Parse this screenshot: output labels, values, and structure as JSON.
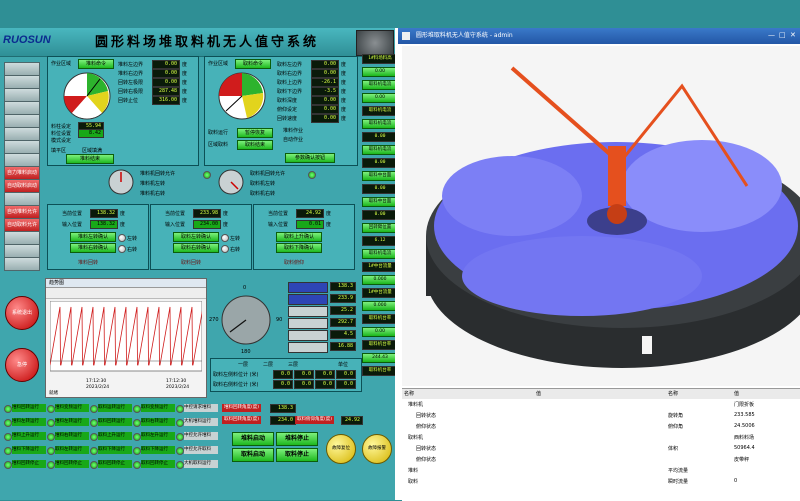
{
  "header": {
    "logo": "RUOSUN",
    "title": "圆形料场堆取料机无人值守系统"
  },
  "sidebar_buttons": [
    "",
    "",
    "",
    "",
    "",
    "",
    "",
    "",
    "自力堆料启动请",
    "自动取料启动请",
    "",
    "自动堆料允许",
    "自动取料允许",
    "",
    "",
    ""
  ],
  "round_buttons": {
    "stop": "系统退出",
    "alarm": "急停"
  },
  "stacker_panel": {
    "mode_label": "作业区域",
    "mode_value": "堆料命令",
    "fields": [
      {
        "label": "堆料左边界",
        "value": "0.00",
        "unit": "度"
      },
      {
        "label": "堆料右边界",
        "value": "0.00",
        "unit": "度"
      },
      {
        "label": "回转左极限",
        "value": "0.00",
        "unit": "度"
      },
      {
        "label": "回转右极限",
        "value": "287.48",
        "unit": "度"
      },
      {
        "label": "回转止位",
        "value": "316.00",
        "unit": "度"
      }
    ],
    "extra": [
      {
        "label": "料柱设定",
        "value": "55.94"
      },
      {
        "label": "料位设置",
        "value": "8.42"
      },
      {
        "label": "模式设定",
        "value": ""
      }
    ],
    "check1": "填平区",
    "check2": "区域填满",
    "confirm": "堆料结束"
  },
  "reclaimer_panel": {
    "mode_label": "作业区域",
    "mode_value": "取料命令",
    "fields": [
      {
        "label": "取料左边界",
        "value": "0.00",
        "unit": "度"
      },
      {
        "label": "取料右边界",
        "value": "0.00",
        "unit": "度"
      },
      {
        "label": "取料上边界",
        "value": "-26.1",
        "unit": "度"
      },
      {
        "label": "取料下边界",
        "value": "-3.5",
        "unit": "度"
      },
      {
        "label": "取料深度",
        "value": "0.00",
        "unit": "度"
      },
      {
        "label": "俯仰设定",
        "value": "0.00",
        "unit": "度"
      },
      {
        "label": "回转速度",
        "value": "0.00",
        "unit": "度"
      }
    ],
    "checks": [
      "堆料作业",
      "自动作业"
    ],
    "btn1": "参数确认按钮",
    "btn2": "参数确认按钮",
    "sub": [
      "取料运行",
      "暂停恢复",
      "区域取料",
      "取料结束"
    ]
  },
  "compass1": {
    "label": "堆料机回转允许",
    "sub": [
      "堆料机左转",
      "堆料机右转"
    ]
  },
  "compass2": {
    "label": "取料机回转允许",
    "sub": [
      "取料机左转",
      "取料机右转"
    ]
  },
  "positions": [
    {
      "cur_label": "当前位置",
      "cur": "138.32",
      "in_label": "输入位置",
      "in": "138.32",
      "unit": "度",
      "b1": "堆料左转确认",
      "b2": "堆料右转确认",
      "r1": "左转",
      "r2": "右转",
      "foot": "堆料回转"
    },
    {
      "cur_label": "当前位置",
      "cur": "233.98",
      "in_label": "输入位置",
      "in": "234.00",
      "unit": "度",
      "b1": "取料左转确认",
      "b2": "取料右转确认",
      "r1": "左转",
      "r2": "右转",
      "foot": "取料回转"
    },
    {
      "cur_label": "当前位置",
      "cur": "24.92",
      "in_label": "输入位置",
      "in": "0.01",
      "unit": "度",
      "b1": "取料上升确认",
      "b2": "取料下降确认",
      "r1": "",
      "r2": "",
      "foot": "取料俯仰"
    }
  ],
  "trend": {
    "title": "趋势图",
    "times": [
      "17:12:30",
      "17:12:30"
    ],
    "dates": [
      "2023/2/24",
      "2023/2/24"
    ],
    "footer": "就绪",
    "y_ticks": [
      "",
      "",
      "",
      "",
      ""
    ]
  },
  "dial": {
    "ticks": [
      "0",
      "90",
      "180",
      "270"
    ]
  },
  "mid_list": {
    "rows": [
      {
        "label": "",
        "value": "138.3"
      },
      {
        "label": "",
        "value": "233.9"
      },
      {
        "label": "",
        "value": "25.2"
      },
      {
        "label": "",
        "value": "292.7"
      },
      {
        "label": "",
        "value": "4.5"
      },
      {
        "label": "",
        "value": "16.88"
      }
    ]
  },
  "table": {
    "headers": [
      "",
      "一层",
      "二层",
      "三层",
      "",
      "单位"
    ],
    "rows": [
      {
        "label": "取料左侧料位计 (米)",
        "v": [
          "0.0",
          "0.0",
          "0.0",
          "0.0"
        ]
      },
      {
        "label": "取料右侧料位计 (米)",
        "v": [
          "0.0",
          "0.0",
          "0.0",
          "0.0"
        ]
      }
    ]
  },
  "bottom": {
    "col1": [
      "堆料回转运行",
      "堆料左转运行",
      "堆料上升运行",
      "堆料下降运行",
      "堆料回转停止"
    ],
    "col2": [
      "堆料变频运行",
      "堆料左转运行",
      "堆料右转运行",
      "取料左转运行",
      "堆料回转停止"
    ],
    "col3": [
      "取料运转运行",
      "取料回转运行",
      "取料上升运行",
      "取料下降运行",
      "取料回转停止"
    ],
    "col4": [
      "取料变频运行",
      "取料右转运行",
      "取料左升运行",
      "取料下降运行",
      "取料回转停止"
    ],
    "col5": [
      "中控请求堆料",
      "大机堆料运行",
      "中控允许堆料",
      "中控允许取料",
      "大机取料运行"
    ],
    "angles": [
      {
        "label": "堆料回转角度(度)",
        "value": "138.3"
      },
      {
        "label": "取料回转角度(度)",
        "value": "234.0"
      }
    ],
    "angle3": {
      "label": "取料俯仰角度(度)",
      "value": "24.92"
    },
    "actions": [
      "堆料启动",
      "堆料停止",
      "取料启动",
      "取料停止"
    ],
    "round1": "故障复位",
    "round2": "故障报警"
  },
  "side_column": [
    {
      "t": "d",
      "v": "1#料场料高"
    },
    {
      "t": "g",
      "v": "0.00"
    },
    {
      "t": "g",
      "v": "取料机电流"
    },
    {
      "t": "g",
      "v": "0.00"
    },
    {
      "t": "d",
      "v": "取料机电流"
    },
    {
      "t": "g",
      "v": "取料机电流"
    },
    {
      "t": "d",
      "v": "0.00"
    },
    {
      "t": "g",
      "v": "取料机电流"
    },
    {
      "t": "d",
      "v": "0.00"
    },
    {
      "t": "g",
      "v": "取料中台面"
    },
    {
      "t": "d",
      "v": "0.00"
    },
    {
      "t": "g",
      "v": "取料中台面"
    },
    {
      "t": "d",
      "v": "0.00"
    },
    {
      "t": "g",
      "v": "回转臂位置"
    },
    {
      "t": "d",
      "v": "6.12"
    },
    {
      "t": "g",
      "v": "取料机电流"
    },
    {
      "t": "d",
      "v": "1#中台流量"
    },
    {
      "t": "g",
      "v": "0.000"
    },
    {
      "t": "d",
      "v": "1#中台流量"
    },
    {
      "t": "g",
      "v": "0.000"
    },
    {
      "t": "d",
      "v": "取料机台率"
    },
    {
      "t": "g",
      "v": "0.00"
    },
    {
      "t": "d",
      "v": "取料机台率"
    },
    {
      "t": "g",
      "v": "244.43"
    },
    {
      "t": "d",
      "v": "取料机台率"
    }
  ],
  "viewer": {
    "title": "圆形堆取料机无人值守系统 - admin",
    "win_controls": [
      "—",
      "□",
      "✕"
    ],
    "tree_headers": [
      "名称",
      "值",
      "名称",
      "值"
    ],
    "tree_items": [
      "堆料机",
      "回转状态",
      "俯仰状态",
      "取料机",
      "回转状态",
      "俯仰状态",
      "堆料",
      "取料"
    ],
    "props": [
      {
        "name": "",
        "value": "门限折板"
      },
      {
        "name": "旋转角",
        "value": "233.585"
      },
      {
        "name": "俯仰角",
        "value": "24.5006"
      },
      {
        "name": "",
        "value": "西料料场"
      },
      {
        "name": "体积",
        "value": "50964.4"
      },
      {
        "name": "",
        "value": "皮带秤"
      },
      {
        "name": "平均流量",
        "value": ""
      },
      {
        "name": "瞬时流量",
        "value": "0"
      }
    ]
  },
  "colors": {
    "panel_bg": "#47b2b8",
    "lcd_text": "#d9ff46",
    "green_btn": "#1eb81e",
    "terrain": "#6b6ef0",
    "machine": "#e5501e"
  }
}
